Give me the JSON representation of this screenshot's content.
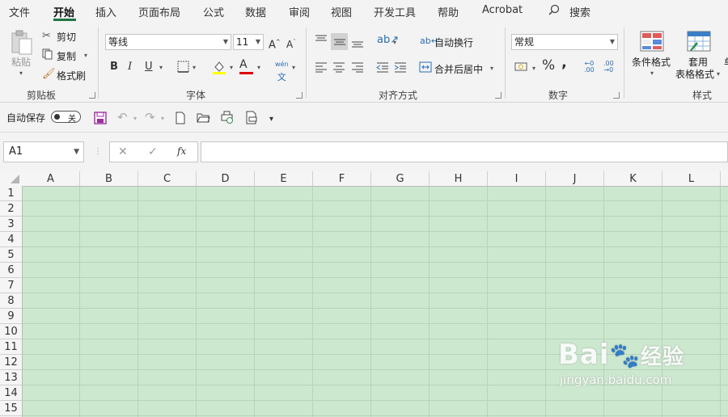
{
  "menu": {
    "items": [
      "文件",
      "开始",
      "插入",
      "页面布局",
      "公式",
      "数据",
      "审阅",
      "视图",
      "开发工具",
      "帮助",
      "Acrobat"
    ],
    "active": "开始",
    "search": "搜索"
  },
  "ribbon": {
    "clipboard": {
      "paste": "粘贴",
      "cut": "剪切",
      "copy": "复制",
      "format_painter": "格式刷",
      "label": "剪贴板"
    },
    "font": {
      "name": "等线",
      "size": "11",
      "bold": "B",
      "italic": "I",
      "underline": "U",
      "increase": "A",
      "decrease": "A",
      "color_letter": "A",
      "phonetic": "wén",
      "label": "字体"
    },
    "alignment": {
      "wrap": "自动换行",
      "merge": "合并后居中",
      "label": "对齐方式"
    },
    "number": {
      "format": "常规",
      "percent": "%",
      "comma": ",",
      "label": "数字"
    },
    "styles": {
      "conditional": "条件格式",
      "table_format_1": "套用",
      "table_format_2": "表格格式",
      "label": "样式"
    }
  },
  "qat": {
    "autosave": "自动保存",
    "toggle": "关"
  },
  "formula_bar": {
    "namebox": "A1",
    "cancel": "✕",
    "enter": "✓",
    "fx": "fx",
    "value": ""
  },
  "grid": {
    "columns": [
      "A",
      "B",
      "C",
      "D",
      "E",
      "F",
      "G",
      "H",
      "I",
      "J",
      "K",
      "L"
    ],
    "rows": [
      "1",
      "2",
      "3",
      "4",
      "5",
      "6",
      "7",
      "8",
      "9",
      "10",
      "11",
      "12",
      "13",
      "14",
      "15"
    ]
  },
  "colors": {
    "sheet_bg": "#cce8cf",
    "accent": "#217346"
  },
  "watermark": {
    "brand": "Bai",
    "brand2": "经验",
    "url": "jingyan.baidu.com"
  }
}
